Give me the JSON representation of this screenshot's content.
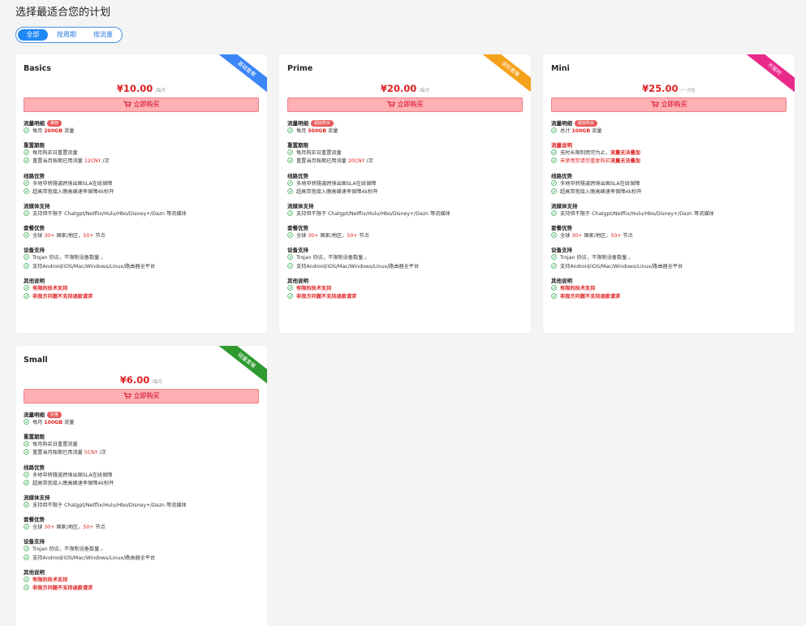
{
  "page_title": "选择最适合您的计划",
  "filter_tabs": [
    {
      "label": "全部",
      "active": true
    },
    {
      "label": "按周期",
      "active": false
    },
    {
      "label": "按流量",
      "active": false
    }
  ],
  "buy_label": "立即购买",
  "colors": {
    "accent_blue": "#1e88f5",
    "price_red": "#e02020",
    "check_green": "#2ea84a",
    "ribbon_blue": "#3b86f6",
    "ribbon_orange": "#f5a21b",
    "ribbon_pink": "#ea2a8a",
    "ribbon_green": "#2f9a2f"
  },
  "plans": [
    {
      "name": "Basics",
      "ribbon": "基础套餐",
      "ribbon_color": "#3b86f6",
      "price": "¥10.00",
      "period": "/每月",
      "sections": {
        "traffic": {
          "title": "流量明细",
          "badge": "推荐",
          "items": [
            [
              "每月 ",
              "200GB",
              " 流量"
            ]
          ]
        },
        "reset": {
          "title": "重置期限",
          "items": [
            [
              "每月购买日重置流量"
            ],
            [
              "重置当月账期已用流量 ",
              "12CNY",
              " /次"
            ]
          ]
        },
        "line": {
          "title": "线路优势",
          "items": [
            [
              "多地中转隧道跨境出国SLA在线保障"
            ],
            [
              "超高带宽接入晚高峰速率保障4k秒开"
            ]
          ]
        },
        "media": {
          "title": "流媒体支持",
          "items": [
            [
              "支持但不限于 Chatgpt/Netflix/Hulu/Hbo/Disney+/Dazn 等流媒体"
            ]
          ]
        },
        "adv": {
          "title": "套餐优势",
          "items": [
            [
              "全球 ",
              "30+",
              " 国家/地区，",
              "50+",
              " 节点"
            ]
          ]
        },
        "device": {
          "title": "设备支持",
          "items": [
            [
              "Trojan 协议，不限制设备数量 。"
            ],
            [
              "支持Android/iOS/Mac/Windows/Linux/路由器全平台"
            ]
          ]
        },
        "other": {
          "title": "其他说明",
          "items": [
            [
              "有限的技术支持"
            ],
            [
              "非我方问题不支持退款请求"
            ]
          ]
        }
      }
    },
    {
      "name": "Prime",
      "ribbon": "进阶套餐",
      "ribbon_color": "#f5a21b",
      "price": "¥20.00",
      "period": "/每月",
      "sections": {
        "traffic": {
          "title": "流量明细",
          "badge": "超级购买",
          "items": [
            [
              "每月 ",
              "500GB",
              " 流量"
            ]
          ]
        },
        "reset": {
          "title": "重置期限",
          "items": [
            [
              "每月购买日重置流量"
            ],
            [
              "重置当月账期已用流量 ",
              "20CNY",
              " /次"
            ]
          ]
        },
        "line": {
          "title": "线路优势",
          "items": [
            [
              "多地中转隧道跨境出国SLA在线保障"
            ],
            [
              "超高带宽接入晚高峰速率保障4k秒开"
            ]
          ]
        },
        "media": {
          "title": "流媒体支持",
          "items": [
            [
              "支持但不限于 Chatgpt/Netflix/Hulu/Hbo/Disney+/Dazn 等流媒体"
            ]
          ]
        },
        "adv": {
          "title": "套餐优势",
          "items": [
            [
              "全球 ",
              "30+",
              " 国家/地区，",
              "50+",
              " 节点"
            ]
          ]
        },
        "device": {
          "title": "设备支持",
          "items": [
            [
              "Trojan 协议，不限制设备数量 。"
            ],
            [
              "支持Android/iOS/Mac/Windows/Linux/路由器全平台"
            ]
          ]
        },
        "other": {
          "title": "其他说明",
          "items": [
            [
              "有限的技术支持"
            ],
            [
              "非我方问题不支持退款请求"
            ]
          ]
        }
      }
    },
    {
      "name": "Mini",
      "ribbon": "不限时",
      "ribbon_color": "#ea2a8a",
      "price": "¥25.00",
      "period": "/一次性",
      "sections": {
        "traffic": {
          "title": "流量明细",
          "badge": "超级购买",
          "items": [
            [
              "总计 ",
              "100GB",
              " 流量"
            ]
          ]
        },
        "note": {
          "title": "流量说明",
          "items": [
            [
              "无时长限制用完为止，",
              "流量无法叠加"
            ],
            [
              "未使用完请勿重复购买",
              "流量无法叠加"
            ]
          ]
        },
        "line": {
          "title": "线路优势",
          "items": [
            [
              "多地中转隧道跨境出国SLA在线保障"
            ],
            [
              "超高带宽接入晚高峰速率保障4k秒开"
            ]
          ]
        },
        "media": {
          "title": "流媒体支持",
          "items": [
            [
              "支持但不限于 Chatgpt/Netflix/Hulu/Hbo/Disney+/Dazn 等流媒体"
            ]
          ]
        },
        "adv": {
          "title": "套餐优势",
          "items": [
            [
              "全球 ",
              "30+",
              " 国家/地区，",
              "50+",
              " 节点"
            ]
          ]
        },
        "device": {
          "title": "设备支持",
          "items": [
            [
              "Trojan 协议，不限制设备数量 。"
            ],
            [
              "支持Android/iOS/Mac/Windows/Linux/路由器全平台"
            ]
          ]
        },
        "other": {
          "title": "其他说明",
          "items": [
            [
              "有限的技术支持"
            ],
            [
              "非我方问题不支持退款请求"
            ]
          ]
        }
      }
    },
    {
      "name": "Small",
      "ribbon": "轻量套餐",
      "ribbon_color": "#2f9a2f",
      "price": "¥6.00",
      "period": "/每月",
      "sections": {
        "traffic": {
          "title": "流量明细",
          "badge": "轻量",
          "items": [
            [
              "每月 ",
              "100GB",
              " 流量"
            ]
          ]
        },
        "reset": {
          "title": "重置期限",
          "items": [
            [
              "每月购买日重置流量"
            ],
            [
              "重置当月账期已用流量 ",
              "5CNY",
              " /次"
            ]
          ]
        },
        "line": {
          "title": "线路优势",
          "items": [
            [
              "多地中转隧道跨境出国SLA在线保障"
            ],
            [
              "超高带宽接入晚高峰速率保障4k秒开"
            ]
          ]
        },
        "media": {
          "title": "流媒体支持",
          "items": [
            [
              "支持但不限于 Chatgpt/Netflix/Hulu/Hbo/Disney+/Dazn 等流媒体"
            ]
          ]
        },
        "adv": {
          "title": "套餐优势",
          "items": [
            [
              "全球 ",
              "30+",
              " 国家/地区，",
              "50+",
              " 节点"
            ]
          ]
        },
        "device": {
          "title": "设备支持",
          "items": [
            [
              "Trojan 协议，不限制设备数量 。"
            ],
            [
              "支持Android/iOS/Mac/Windows/Linux/路由器全平台"
            ]
          ]
        },
        "other": {
          "title": "其他说明",
          "items": [
            [
              "有限的技术支持"
            ],
            [
              "非我方问题不支持退款请求"
            ]
          ]
        }
      }
    }
  ]
}
